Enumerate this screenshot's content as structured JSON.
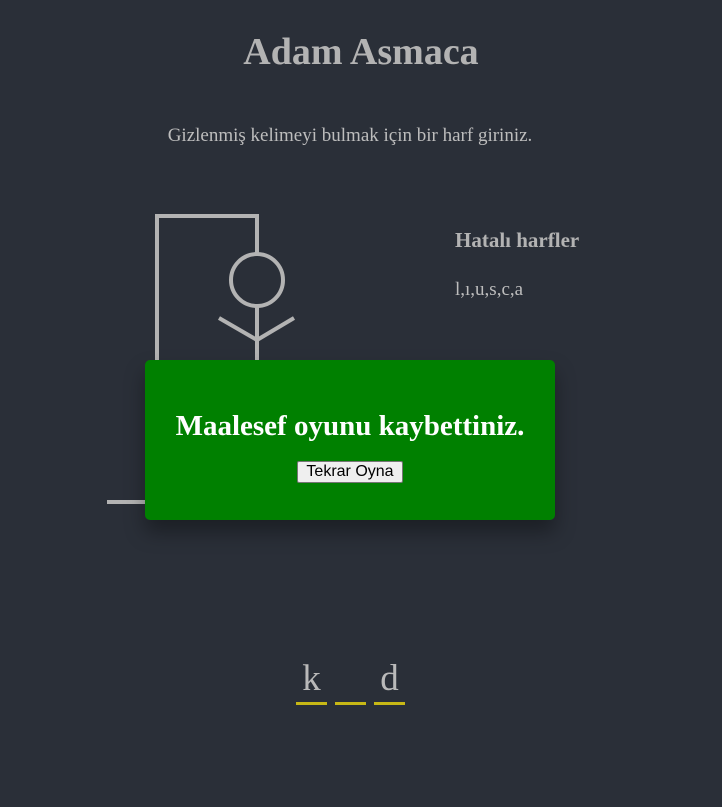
{
  "game": {
    "title": "Adam Asmaca",
    "instruction": "Gizlenmiş kelimeyi bulmak için bir harf giriniz."
  },
  "wrong_letters": {
    "title": "Hatalı harfler",
    "letters": "l,ı,u,s,c,a"
  },
  "popup": {
    "message": "Maalesef oyunu kaybettiniz.",
    "button_label": "Tekrar Oyna"
  },
  "word": {
    "slots": [
      "k",
      "",
      "d"
    ]
  },
  "colors": {
    "background": "#2a2f38",
    "figure": "#b3b3b3",
    "popup": "#008000",
    "underline": "#c7b816"
  }
}
